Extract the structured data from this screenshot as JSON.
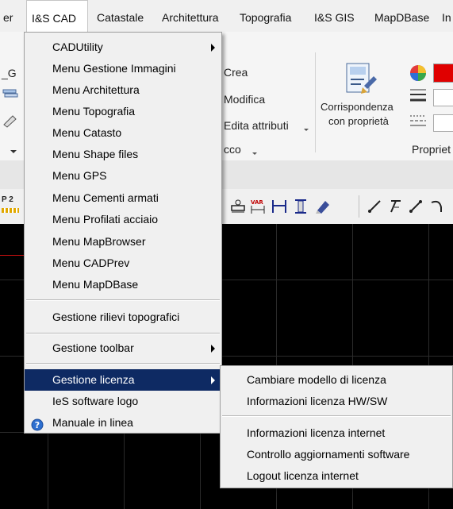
{
  "menubar": {
    "items": [
      {
        "label": "er"
      },
      {
        "label": "I&S CAD"
      },
      {
        "label": "Catastale"
      },
      {
        "label": "Architettura"
      },
      {
        "label": "Topografia"
      },
      {
        "label": "I&S GIS"
      },
      {
        "label": "MapDBase"
      },
      {
        "label": "In"
      }
    ]
  },
  "ribbon": {
    "left_label": "_G",
    "create_label": "Crea",
    "modify_label": "Modifica",
    "edit_attributes_label": "Edita attributi",
    "block_label": "cco",
    "match_properties_line1": "Corrispondenza",
    "match_properties_line2": "con proprietà",
    "properties_label": "Propriet",
    "toolbar_left_label": "P 2",
    "var_label": "VAR"
  },
  "menu": {
    "items": [
      {
        "label": "CADUtility",
        "submenu": true
      },
      {
        "label": "Menu Gestione Immagini"
      },
      {
        "label": "Menu Architettura"
      },
      {
        "label": "Menu Topografia"
      },
      {
        "label": "Menu Catasto"
      },
      {
        "label": "Menu Shape files"
      },
      {
        "label": "Menu GPS"
      },
      {
        "label": "Menu Cementi armati"
      },
      {
        "label": "Menu Profilati acciaio"
      },
      {
        "label": "Menu MapBrowser"
      },
      {
        "label": "Menu CADPrev"
      },
      {
        "label": "Menu MapDBase"
      },
      {
        "label": "Gestione rilievi topografici"
      },
      {
        "label": "Gestione toolbar",
        "submenu": true
      },
      {
        "label": "Gestione licenza",
        "submenu": true
      },
      {
        "label": "IeS software logo"
      },
      {
        "label": "Manuale in linea"
      }
    ]
  },
  "submenu": {
    "items": [
      {
        "label": "Cambiare modello di licenza"
      },
      {
        "label": "Informazioni licenza HW/SW"
      },
      {
        "label": "Informazioni licenza internet"
      },
      {
        "label": "Controllo aggiornamenti software"
      },
      {
        "label": "Logout licenza internet"
      }
    ]
  },
  "colors": {
    "highlight": "#0e2a63",
    "canvas": "#000000"
  }
}
